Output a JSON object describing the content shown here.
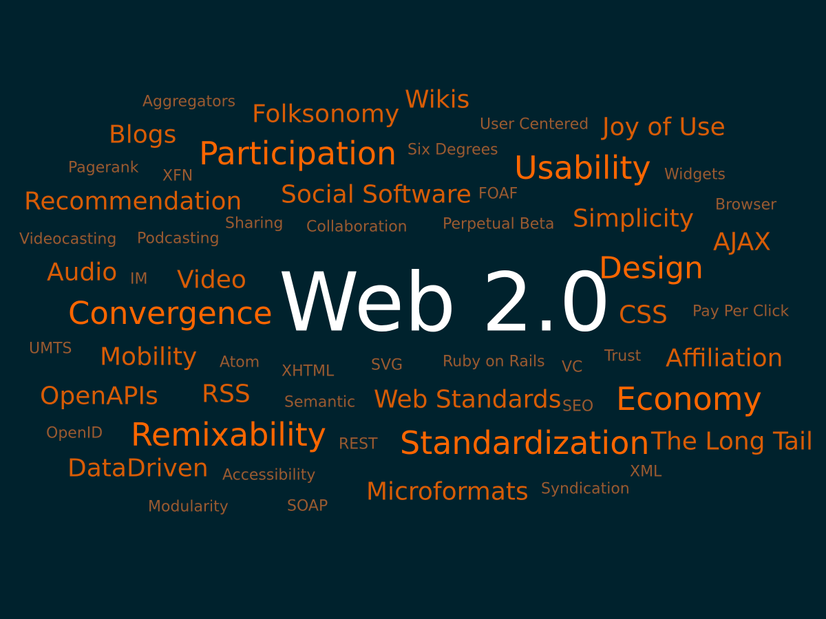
{
  "title": "Web 2.0",
  "colors": {
    "background": "#00222d",
    "title": "#ffffff",
    "tier1": "#ff6600",
    "tier2": "#d85c06",
    "tier3": "#9a5a30"
  },
  "words": [
    {
      "text": "Web 2.0",
      "tier": 0
    },
    {
      "text": "Participation",
      "tier": 1
    },
    {
      "text": "Usability",
      "tier": 1
    },
    {
      "text": "Standardization",
      "tier": 1
    },
    {
      "text": "Remixability",
      "tier": 1
    },
    {
      "text": "Convergence",
      "tier": 1
    },
    {
      "text": "Economy",
      "tier": 1
    },
    {
      "text": "Design",
      "tier": 1
    },
    {
      "text": "Folksonomy",
      "tier": 2
    },
    {
      "text": "Wikis",
      "tier": 2
    },
    {
      "text": "Joy of Use",
      "tier": 2
    },
    {
      "text": "Blogs",
      "tier": 2
    },
    {
      "text": "Recommendation",
      "tier": 2
    },
    {
      "text": "Social Software",
      "tier": 2
    },
    {
      "text": "Simplicity",
      "tier": 2
    },
    {
      "text": "AJAX",
      "tier": 2
    },
    {
      "text": "Audio",
      "tier": 2
    },
    {
      "text": "Video",
      "tier": 2
    },
    {
      "text": "CSS",
      "tier": 2
    },
    {
      "text": "Mobility",
      "tier": 2
    },
    {
      "text": "Affiliation",
      "tier": 2
    },
    {
      "text": "OpenAPIs",
      "tier": 2
    },
    {
      "text": "RSS",
      "tier": 2
    },
    {
      "text": "Web Standards",
      "tier": 2
    },
    {
      "text": "The Long Tail",
      "tier": 2
    },
    {
      "text": "DataDriven",
      "tier": 2
    },
    {
      "text": "Microformats",
      "tier": 2
    },
    {
      "text": "Aggregators",
      "tier": 3
    },
    {
      "text": "User Centered",
      "tier": 3
    },
    {
      "text": "Six Degrees",
      "tier": 3
    },
    {
      "text": "Pagerank",
      "tier": 3
    },
    {
      "text": "XFN",
      "tier": 3
    },
    {
      "text": "Widgets",
      "tier": 3
    },
    {
      "text": "FOAF",
      "tier": 3
    },
    {
      "text": "Browser",
      "tier": 3
    },
    {
      "text": "Sharing",
      "tier": 3
    },
    {
      "text": "Collaboration",
      "tier": 3
    },
    {
      "text": "Perpetual Beta",
      "tier": 3
    },
    {
      "text": "Videocasting",
      "tier": 3
    },
    {
      "text": "Podcasting",
      "tier": 3
    },
    {
      "text": "IM",
      "tier": 3
    },
    {
      "text": "Pay Per Click",
      "tier": 3
    },
    {
      "text": "UMTS",
      "tier": 3
    },
    {
      "text": "Atom",
      "tier": 3
    },
    {
      "text": "XHTML",
      "tier": 3
    },
    {
      "text": "SVG",
      "tier": 3
    },
    {
      "text": "Ruby on Rails",
      "tier": 3
    },
    {
      "text": "VC",
      "tier": 3
    },
    {
      "text": "Trust",
      "tier": 3
    },
    {
      "text": "Semantic",
      "tier": 3
    },
    {
      "text": "SEO",
      "tier": 3
    },
    {
      "text": "OpenID",
      "tier": 3
    },
    {
      "text": "REST",
      "tier": 3
    },
    {
      "text": "XML",
      "tier": 3
    },
    {
      "text": "Accessibility",
      "tier": 3
    },
    {
      "text": "Syndication",
      "tier": 3
    },
    {
      "text": "Modularity",
      "tier": 3
    },
    {
      "text": "SOAP",
      "tier": 3
    }
  ]
}
